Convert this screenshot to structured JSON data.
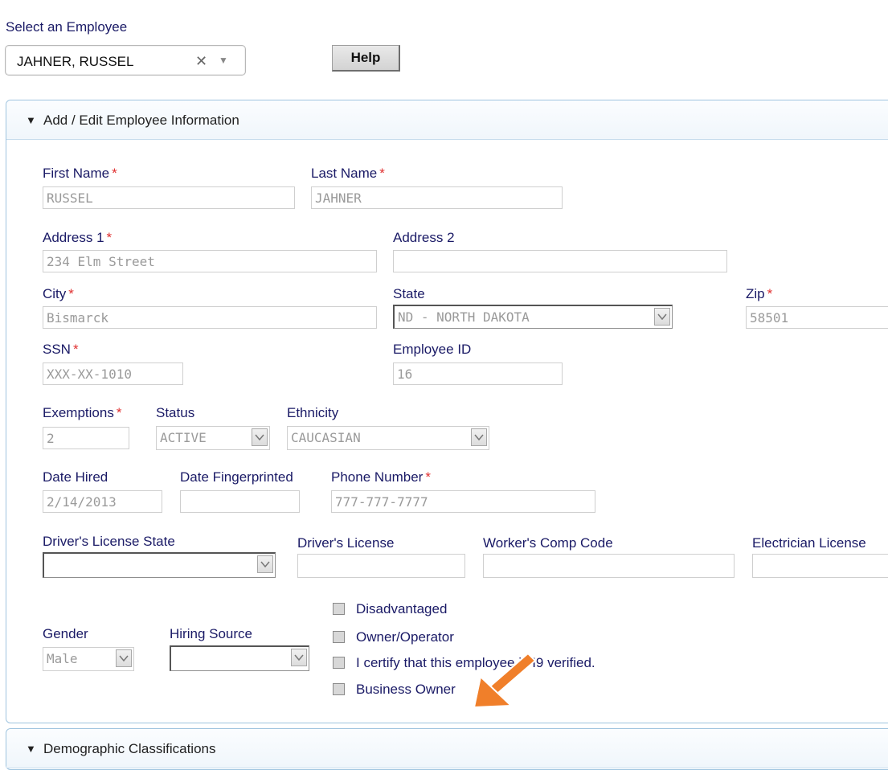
{
  "select_employee": {
    "label": "Select an Employee",
    "value": "JAHNER, RUSSEL",
    "clear_icon": "close-icon",
    "arrow_icon": "chevron-down-icon"
  },
  "help_button": {
    "label": "Help"
  },
  "panel": {
    "title": "Add / Edit Employee Information",
    "first_name": {
      "label": "First Name",
      "required": "*",
      "value": "RUSSEL"
    },
    "last_name": {
      "label": "Last Name",
      "required": "*",
      "value": "JAHNER"
    },
    "address1": {
      "label": "Address 1",
      "required": "*",
      "value": "234 Elm Street"
    },
    "address2": {
      "label": "Address 2",
      "value": ""
    },
    "city": {
      "label": "City",
      "required": "*",
      "value": "Bismarck"
    },
    "state": {
      "label": "State",
      "value": "ND - NORTH DAKOTA"
    },
    "zip": {
      "label": "Zip",
      "required": "*",
      "value": "58501"
    },
    "ssn": {
      "label": "SSN",
      "required": "*",
      "value": "XXX-XX-1010"
    },
    "employee_id": {
      "label": "Employee ID",
      "value": "16"
    },
    "exemptions": {
      "label": "Exemptions",
      "required": "*",
      "value": "2"
    },
    "status": {
      "label": "Status",
      "value": "ACTIVE"
    },
    "ethnicity": {
      "label": "Ethnicity",
      "value": "CAUCASIAN"
    },
    "date_hired": {
      "label": "Date Hired",
      "value": "2/14/2013"
    },
    "date_fingerprinted": {
      "label": "Date Fingerprinted",
      "value": ""
    },
    "phone": {
      "label": "Phone Number",
      "required": "*",
      "value": "777-777-7777"
    },
    "dl_state": {
      "label": "Driver's License State",
      "value": ""
    },
    "dl": {
      "label": "Driver's License",
      "value": ""
    },
    "workers_comp": {
      "label": "Worker's Comp Code",
      "value": ""
    },
    "electrician": {
      "label": "Electrician License",
      "value": ""
    },
    "gender": {
      "label": "Gender",
      "value": "Male"
    },
    "hiring_source": {
      "label": "Hiring Source",
      "value": ""
    },
    "checkboxes": {
      "disadvantaged": "Disadvantaged",
      "owner_operator": "Owner/Operator",
      "i9": "I certify that this employee is I9 verified.",
      "business_owner": "Business Owner"
    }
  },
  "panel2": {
    "title": "Demographic Classifications"
  },
  "annotation": {
    "arrow_color": "#f07f2a",
    "icon": "arrow-pointer-icon"
  }
}
